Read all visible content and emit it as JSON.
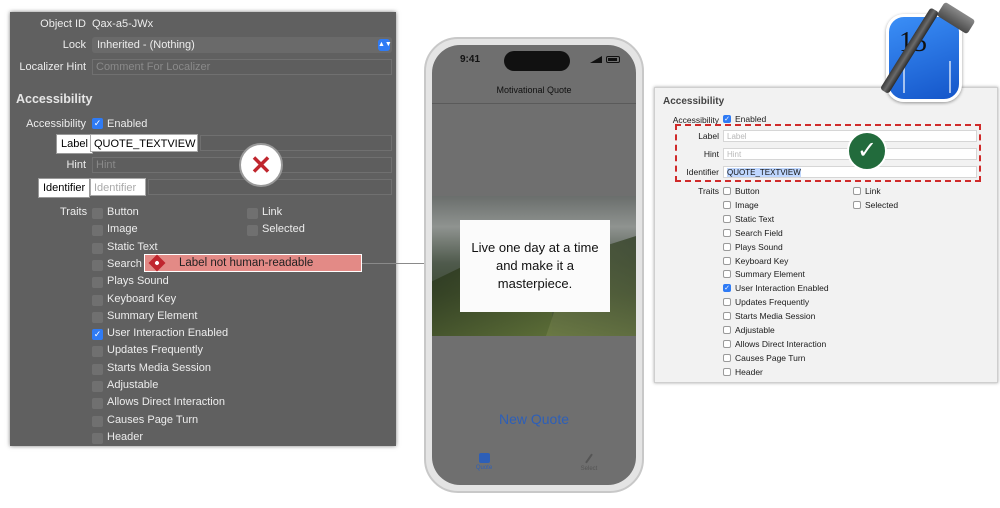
{
  "left_inspector": {
    "object_id_label": "Object ID",
    "object_id_value": "Qax-a5-JWx",
    "lock_label": "Lock",
    "lock_value": "Inherited - (Nothing)",
    "localizer_hint_label": "Localizer Hint",
    "localizer_hint_placeholder": "Comment For Localizer",
    "section_title": "Accessibility",
    "accessibility_label": "Accessibility",
    "enabled_label": "Enabled",
    "label_label": "Label",
    "label_value": "QUOTE_TEXTVIEW",
    "hint_label": "Hint",
    "hint_placeholder": "Hint",
    "identifier_label": "Identifier",
    "identifier_placeholder": "Identifier",
    "traits_label": "Traits",
    "traits_left": [
      {
        "label": "Button",
        "checked": false
      },
      {
        "label": "Image",
        "checked": false
      },
      {
        "label": "Static Text",
        "checked": false
      },
      {
        "label": "Search",
        "checked": false
      },
      {
        "label": "Plays Sound",
        "checked": false
      },
      {
        "label": "Keyboard Key",
        "checked": false
      },
      {
        "label": "Summary Element",
        "checked": false
      },
      {
        "label": "User Interaction Enabled",
        "checked": true
      },
      {
        "label": "Updates Frequently",
        "checked": false
      },
      {
        "label": "Starts Media Session",
        "checked": false
      },
      {
        "label": "Adjustable",
        "checked": false
      },
      {
        "label": "Allows Direct Interaction",
        "checked": false
      },
      {
        "label": "Causes Page Turn",
        "checked": false
      },
      {
        "label": "Header",
        "checked": false
      }
    ],
    "traits_right": [
      {
        "label": "Link",
        "checked": false
      },
      {
        "label": "Selected",
        "checked": false
      }
    ],
    "warning_text": "Label not human-readable",
    "error_icon": "x-mark-icon"
  },
  "phone": {
    "time": "9:41",
    "nav_title": "Motivational Quote",
    "quote_text": "Live one day at a time and make it a masterpiece.",
    "new_quote_button": "New Quote",
    "tabs": [
      {
        "label": "Quote",
        "icon": "quote-bubble-icon"
      },
      {
        "label": "Select",
        "icon": "pencil-icon"
      }
    ]
  },
  "right_inspector": {
    "section_title": "Accessibility",
    "accessibility_label": "Accessibility",
    "enabled_label": "Enabled",
    "label_label": "Label",
    "label_placeholder": "Label",
    "hint_label": "Hint",
    "hint_placeholder": "Hint",
    "identifier_label": "Identifier",
    "identifier_value": "QUOTE_TEXTVIEW",
    "traits_label": "Traits",
    "traits_left": [
      {
        "label": "Button",
        "checked": false
      },
      {
        "label": "Image",
        "checked": false
      },
      {
        "label": "Static Text",
        "checked": false
      },
      {
        "label": "Search Field",
        "checked": false
      },
      {
        "label": "Plays Sound",
        "checked": false
      },
      {
        "label": "Keyboard Key",
        "checked": false
      },
      {
        "label": "Summary Element",
        "checked": false
      },
      {
        "label": "User Interaction Enabled",
        "checked": true
      },
      {
        "label": "Updates Frequently",
        "checked": false
      },
      {
        "label": "Starts Media Session",
        "checked": false
      },
      {
        "label": "Adjustable",
        "checked": false
      },
      {
        "label": "Allows Direct Interaction",
        "checked": false
      },
      {
        "label": "Causes Page Turn",
        "checked": false
      },
      {
        "label": "Header",
        "checked": false
      }
    ],
    "traits_right": [
      {
        "label": "Link",
        "checked": false
      },
      {
        "label": "Selected",
        "checked": false
      }
    ],
    "success_icon": "checkmark-icon"
  },
  "xcode_badge": {
    "version": "15",
    "icon": "xcode-hammer-icon"
  },
  "colors": {
    "accent_blue": "#2f7bf5",
    "error_red": "#c0262e",
    "warning_bg": "#e38a86",
    "success_green": "#226b3c",
    "link_blue": "#2d5fb8"
  }
}
